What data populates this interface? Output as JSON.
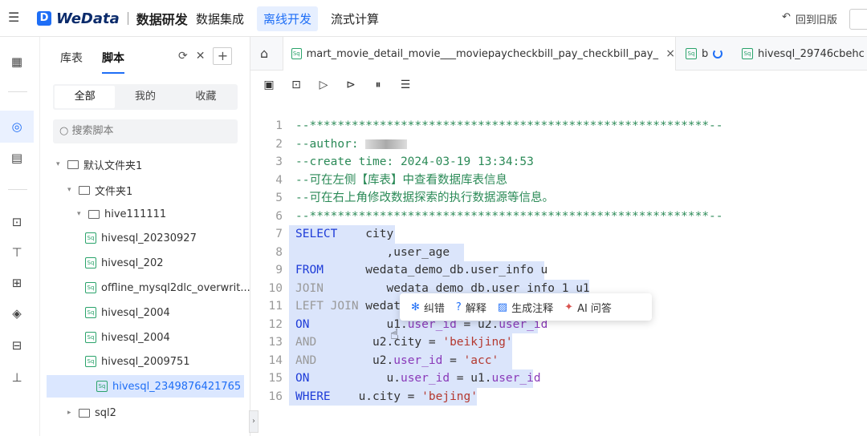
{
  "header": {
    "brand": "WeData",
    "module": "数据研发",
    "nav": [
      "数据集成",
      "离线开发",
      "流式计算"
    ],
    "active_nav": "离线开发",
    "old_version": "回到旧版"
  },
  "left_panel": {
    "tabs": [
      "库表",
      "脚本"
    ],
    "active_tab": "脚本",
    "segments": [
      "全部",
      "我的",
      "收藏"
    ],
    "active_segment": "全部",
    "search_placeholder": "搜索脚本",
    "tree": [
      {
        "label": "默认文件夹1",
        "type": "folder",
        "level": 0,
        "expanded": true
      },
      {
        "label": "文件夹1",
        "type": "folder",
        "level": 1,
        "expanded": true
      },
      {
        "label": "hive111111",
        "type": "folder",
        "level": 2,
        "expanded": true
      },
      {
        "label": "hivesql_20230927",
        "type": "sql",
        "level": 3
      },
      {
        "label": "hivesql_202",
        "type": "sql",
        "level": 3
      },
      {
        "label": "offline_mysql2dlc_overwrit...",
        "type": "sql",
        "level": 3
      },
      {
        "label": "hivesql_2004",
        "type": "sql",
        "level": 3
      },
      {
        "label": "hivesql_2004",
        "type": "sql",
        "level": 3
      },
      {
        "label": "hivesql_2009751",
        "type": "sql",
        "level": 3
      },
      {
        "label": "hivesql_2349876421765",
        "type": "sql",
        "level": 3,
        "selected": true
      },
      {
        "label": "sql2",
        "type": "folder",
        "level": 1,
        "expanded": false
      }
    ]
  },
  "tabs": [
    {
      "label": "mart_movie_detail_movie___moviepaycheckbill_pay_checkbill_pay_bill___D...",
      "active": true
    },
    {
      "label": "b",
      "active": false,
      "loading": true
    },
    {
      "label": "hivesql_29746cbehc",
      "active": false
    }
  ],
  "editor": {
    "lines": [
      {
        "n": "1",
        "parts": [
          {
            "t": "--*********************************************************--",
            "c": "cm"
          }
        ]
      },
      {
        "n": "2",
        "parts": [
          {
            "t": "--author: ",
            "c": "cm"
          }
        ]
      },
      {
        "n": "3",
        "parts": [
          {
            "t": "--create time: 2024-03-19 13:34:53",
            "c": "cm"
          }
        ]
      },
      {
        "n": "4",
        "parts": [
          {
            "t": "--可在左侧【库表】中查看数据库表信息",
            "c": "cm"
          }
        ]
      },
      {
        "n": "5",
        "parts": [
          {
            "t": "--可在右上角修改数据探索的执行数据源等信息。",
            "c": "cm"
          }
        ]
      },
      {
        "n": "6",
        "parts": [
          {
            "t": "--*********************************************************--",
            "c": "cm"
          }
        ]
      },
      {
        "n": "7",
        "parts": [
          {
            "t": "SELECT",
            "c": "kw"
          },
          {
            "t": "    city",
            "c": ""
          }
        ]
      },
      {
        "n": "8",
        "parts": [
          {
            "t": "             ,user_age",
            "c": ""
          }
        ]
      },
      {
        "n": "9",
        "parts": [
          {
            "t": "FROM",
            "c": "kw"
          },
          {
            "t": "      wedata_demo_db.user_info u",
            "c": ""
          }
        ]
      },
      {
        "n": "10",
        "parts": [
          {
            "t": "JOIN",
            "c": "kw2"
          },
          {
            "t": "         wedata_demo_db.user_info_1 u1",
            "c": ""
          }
        ]
      },
      {
        "n": "11",
        "parts": [
          {
            "t": "LEFT JOIN",
            "c": "kw2"
          },
          {
            "t": " wedat",
            "c": ""
          }
        ]
      },
      {
        "n": "12",
        "parts": [
          {
            "t": "ON",
            "c": "kw"
          },
          {
            "t": "           u1.",
            "c": ""
          },
          {
            "t": "user_id",
            "c": "pr"
          },
          {
            "t": " = u2.",
            "c": ""
          },
          {
            "t": "user_id",
            "c": "pr"
          }
        ]
      },
      {
        "n": "13",
        "parts": [
          {
            "t": "AND",
            "c": "kw2"
          },
          {
            "t": "        u2.city = ",
            "c": ""
          },
          {
            "t": "'beikjing'",
            "c": "str"
          }
        ]
      },
      {
        "n": "14",
        "parts": [
          {
            "t": "AND",
            "c": "kw2"
          },
          {
            "t": "        u2.",
            "c": ""
          },
          {
            "t": "user_id",
            "c": "pr"
          },
          {
            "t": " = ",
            "c": ""
          },
          {
            "t": "'acc'",
            "c": "str"
          }
        ]
      },
      {
        "n": "15",
        "parts": [
          {
            "t": "ON",
            "c": "kw"
          },
          {
            "t": "           u.",
            "c": ""
          },
          {
            "t": "user_id",
            "c": "pr"
          },
          {
            "t": " = u1.",
            "c": ""
          },
          {
            "t": "user_id",
            "c": "pr"
          }
        ]
      },
      {
        "n": "16",
        "parts": [
          {
            "t": "WHERE",
            "c": "kw"
          },
          {
            "t": "    u.city = ",
            "c": ""
          },
          {
            "t": "'bejing'",
            "c": "str"
          }
        ]
      }
    ]
  },
  "context_menu": [
    {
      "label": "纠错",
      "icon": "bug-icon"
    },
    {
      "label": "解释",
      "icon": "question-icon"
    },
    {
      "label": "生成注释",
      "icon": "comment-icon"
    },
    {
      "label": "AI 问答",
      "icon": "ai-sparkle-icon"
    }
  ]
}
